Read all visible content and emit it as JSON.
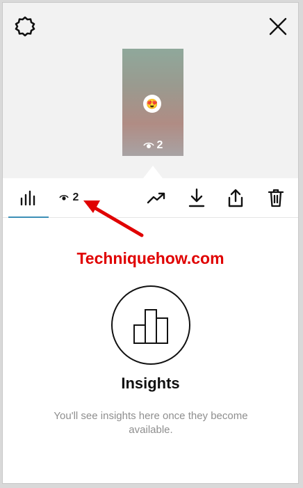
{
  "header": {
    "settings_icon": "gear-icon",
    "close_icon": "close-icon"
  },
  "story": {
    "emoji": "😍",
    "view_count": "2"
  },
  "toolbar": {
    "insights_tab_icon": "bar-chart-icon",
    "viewers_count": "2",
    "actions": [
      "trending-icon",
      "download-icon",
      "share-icon",
      "trash-icon"
    ],
    "active_tab_color": "#3b8fb6"
  },
  "annotation": {
    "watermark": "Techniquehow.com",
    "arrow_color": "#e00000"
  },
  "insights": {
    "title": "Insights",
    "description": "You'll see insights here once they become available."
  }
}
